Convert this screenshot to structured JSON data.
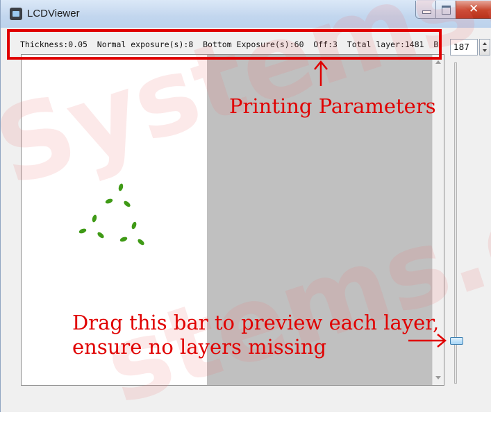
{
  "window": {
    "title": "LCDViewer",
    "controls": [
      "minimize",
      "maximize",
      "close"
    ]
  },
  "params_bar": {
    "text": "Thickness:0.05  Normal exposure(s):8  Bottom Exposure(s):60  Off:3  Total layer:1481  B"
  },
  "layer_spinbox": {
    "value": "187"
  },
  "preview": {
    "background_color": "#ffffff",
    "mask_color": "#c0c0c0",
    "dots_color": "#3f9a16"
  },
  "layer_slider": {
    "level": 0.85
  },
  "annotations": {
    "params_label": "Printing Parameters",
    "slider_label_line1": "Drag this bar to preview each layer,",
    "slider_label_line2": "ensure no layers missing",
    "color": "#e00000"
  },
  "watermark": {
    "text1": "Systems.c",
    "text2": "stems.co"
  }
}
